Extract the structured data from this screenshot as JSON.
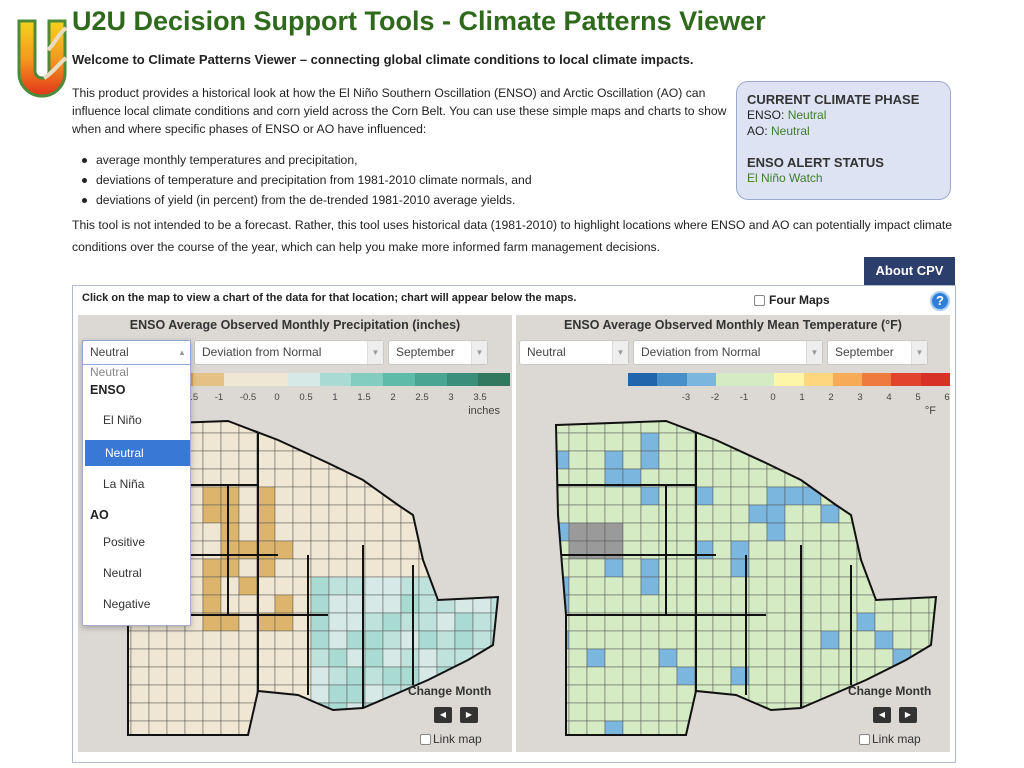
{
  "header": {
    "title": "U2U Decision Support Tools - Climate Patterns Viewer",
    "subtitle": "Welcome to Climate Patterns Viewer – connecting global climate conditions to local climate impacts.",
    "logo_text": "U2U"
  },
  "intro": {
    "text": "This product provides a historical look at how the El Niño Southern Oscillation (ENSO) and Arctic Oscillation (AO) can influence local climate conditions and corn yield across the Corn Belt. You can use these simple maps and charts to show when and where specific phases of ENSO or AO have influenced:",
    "bullets": [
      "average monthly temperatures and precipitation,",
      "deviations of temperature and precipitation from 1981-2010 climate normals, and",
      "deviations of yield (in percent) from the de-trended 1981-2010 average yields."
    ],
    "closing": "This tool is not intended to be a forecast. Rather, this tool uses historical data (1981-2010) to highlight locations where ENSO and AO can potentially impact climate conditions over the course of the year, which can help you make more informed farm management decisions."
  },
  "phase_box": {
    "heading": "CURRENT CLIMATE PHASE",
    "enso_label": "ENSO:",
    "enso_value": "Neutral",
    "ao_label": "AO:",
    "ao_value": "Neutral",
    "alert_heading": "ENSO ALERT STATUS",
    "alert_value": "El Niño Watch"
  },
  "about_button": "About CPV",
  "instructions": "Click on the map to view a chart of the data for that location; chart will appear below the maps.",
  "four_maps_label": "Four Maps",
  "help_icon": "?",
  "maps": [
    {
      "title": "ENSO Average Observed Monthly Precipitation (inches)",
      "phase": "Neutral",
      "mode": "Deviation from Normal",
      "month": "September",
      "legend_colors": [
        "#d9a54f",
        "#e4c184",
        "#efe6d3",
        "#efe6d3",
        "#d6e9e6",
        "#a9dbd2",
        "#82cdbf",
        "#5fbba9",
        "#4aa692",
        "#3b8e79",
        "#32775f"
      ],
      "legend_ticks": [
        "-1.5",
        "-1",
        "-0.5",
        "0",
        "0.5",
        "1",
        "1.5",
        "2",
        "2.5",
        "3",
        "3.5"
      ],
      "unit": "inches",
      "change_month": "Change Month",
      "link_map": "Link map"
    },
    {
      "title": "ENSO Average Observed Monthly Mean Temperature (°F)",
      "phase": "Neutral",
      "mode": "Deviation from Normal",
      "month": "September",
      "legend_colors": [
        "#2166ac",
        "#4a90c8",
        "#7ab6dd",
        "#d4ebc4",
        "#d4ebc4",
        "#fdf6a8",
        "#fdd67d",
        "#f8ab57",
        "#ee7a3d",
        "#e1432c",
        "#d73027"
      ],
      "legend_ticks": [
        "-3",
        "-2",
        "-1",
        "0",
        "1",
        "2",
        "3",
        "4",
        "5",
        "6"
      ],
      "unit": "°F",
      "change_month": "Change Month",
      "link_map": "Link map"
    }
  ],
  "dropdown": {
    "current": "Neutral",
    "groups": [
      {
        "label": "ENSO",
        "options": [
          "El Niño",
          "Neutral",
          "La Niña"
        ]
      },
      {
        "label": "AO",
        "options": [
          "Positive",
          "Neutral",
          "Negative"
        ]
      }
    ],
    "selected": "ENSO/Neutral"
  }
}
